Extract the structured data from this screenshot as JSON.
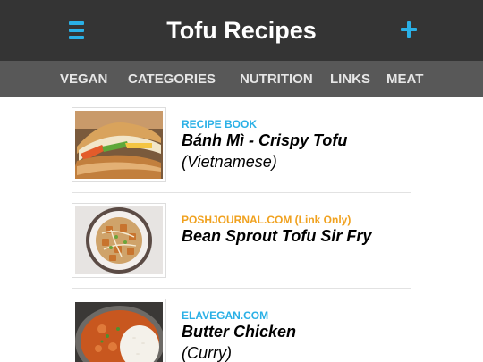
{
  "header": {
    "title": "Tofu Recipes",
    "menu_icon": "hamburger-menu-icon",
    "add_icon": "plus-icon",
    "accent_color": "#2ab0e6"
  },
  "nav": {
    "items": [
      {
        "label": "VEGAN"
      },
      {
        "label": "CATEGORIES"
      },
      {
        "label": "NUTRITION"
      },
      {
        "label": "LINKS"
      },
      {
        "label": "MEAT"
      }
    ]
  },
  "recipes": [
    {
      "source": "RECIPE BOOK",
      "source_color": "#2ab0e6",
      "name": "Bánh Mì - Crispy Tofu",
      "subtitle": "(Vietnamese)",
      "image": "banh-mi-sandwich"
    },
    {
      "source": "POSHJOURNAL.COM (Link Only)",
      "source_color": "#f0a11e",
      "name": "Bean Sprout Tofu Sir Fry",
      "subtitle": "",
      "image": "tofu-stir-fry-plate"
    },
    {
      "source": "ELAVEGAN.COM",
      "source_color": "#2ab0e6",
      "name": "Butter Chicken",
      "subtitle": "(Curry)",
      "image": "curry-with-rice-bowl"
    }
  ]
}
